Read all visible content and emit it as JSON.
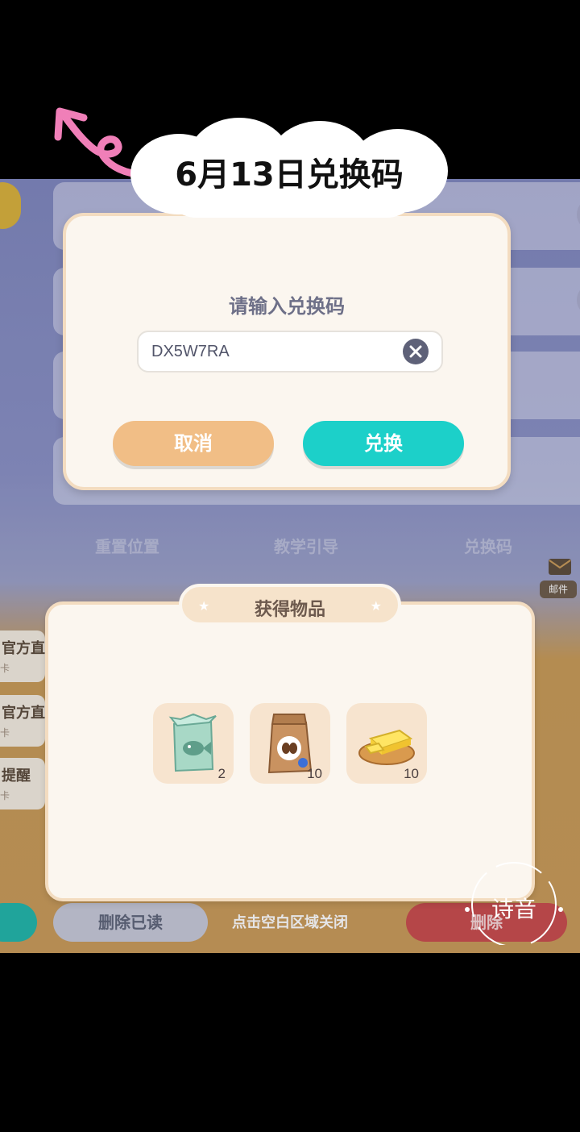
{
  "title_sticker": {
    "text": "6月13日兑换码"
  },
  "background": {
    "tabs": [
      "重置位置",
      "教学引导",
      "兑换码"
    ],
    "mail_items": [
      {
        "title": "官方直",
        "sub": "卡"
      },
      {
        "title": "官方直",
        "sub": "卡"
      },
      {
        "title": "提醒",
        "sub": "卡"
      }
    ],
    "mail_label": "邮件",
    "delete_read_label": "删除已读",
    "delete_label": "删除",
    "tap_hint": "点击空白区域关闭"
  },
  "redeem_dialog": {
    "title": "请输入兑换码",
    "code_value": "DX5W7RA",
    "cancel_label": "取消",
    "redeem_label": "兑换"
  },
  "rewards": {
    "title": "获得物品",
    "items": [
      {
        "icon": "fish-food-box-icon",
        "count": "2"
      },
      {
        "icon": "coffee-bag-icon",
        "count": "10"
      },
      {
        "icon": "butter-icon",
        "count": "10"
      }
    ]
  },
  "watermark": {
    "text": "诗音"
  },
  "colors": {
    "cancel": "#f1be86",
    "redeem": "#1cd0c9",
    "panel": "#fbf6ef",
    "panel_border": "#f3dcc0",
    "arrow": "#f07fb8"
  }
}
